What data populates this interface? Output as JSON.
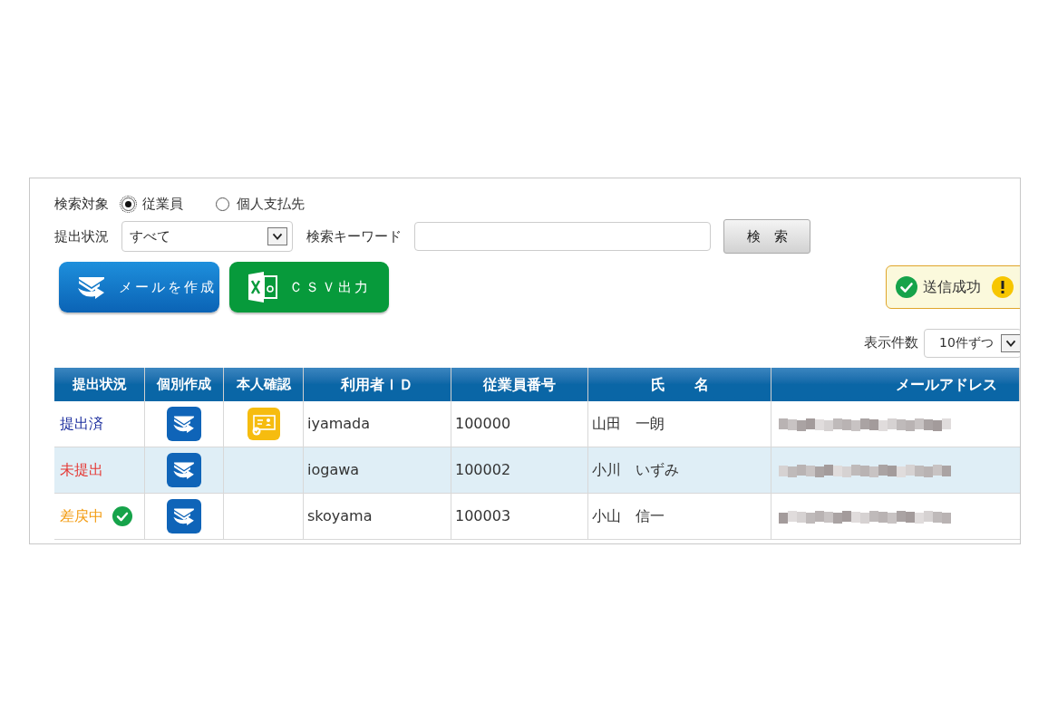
{
  "search_target": {
    "label": "検索対象",
    "options": [
      {
        "label": "従業員",
        "selected": true
      },
      {
        "label": "個人支払先",
        "selected": false
      }
    ]
  },
  "filters": {
    "status_label": "提出状況",
    "status_value": "すべて",
    "keyword_label": "検索キーワード",
    "search_button": "検　索"
  },
  "actions": [
    {
      "kind": "mail",
      "label": "メールを作成"
    },
    {
      "kind": "csv",
      "label": "ＣＳＶ出力"
    }
  ],
  "toast": {
    "text": "送信成功"
  },
  "page_size": {
    "label": "表示件数",
    "value": "10件ずつ"
  },
  "table": {
    "columns": [
      "提出状況",
      "個別作成",
      "本人確認",
      "利用者ＩＤ",
      "従業員番号",
      "氏　　名",
      "メールアドレス"
    ],
    "rows": [
      {
        "status": "提出済",
        "kind": "submitted",
        "returned_check": false,
        "identity_verified": true,
        "user_id": "iyamada",
        "employee_no": "100000",
        "name": "山田　一朗",
        "selected": false
      },
      {
        "status": "未提出",
        "kind": "unsubmitted",
        "returned_check": false,
        "identity_verified": false,
        "user_id": "iogawa",
        "employee_no": "100002",
        "name": "小川　いずみ",
        "selected": true
      },
      {
        "status": "差戻中",
        "kind": "returned",
        "returned_check": true,
        "identity_verified": false,
        "user_id": "skoyama",
        "employee_no": "100003",
        "name": "小山　信一",
        "selected": false
      }
    ]
  }
}
